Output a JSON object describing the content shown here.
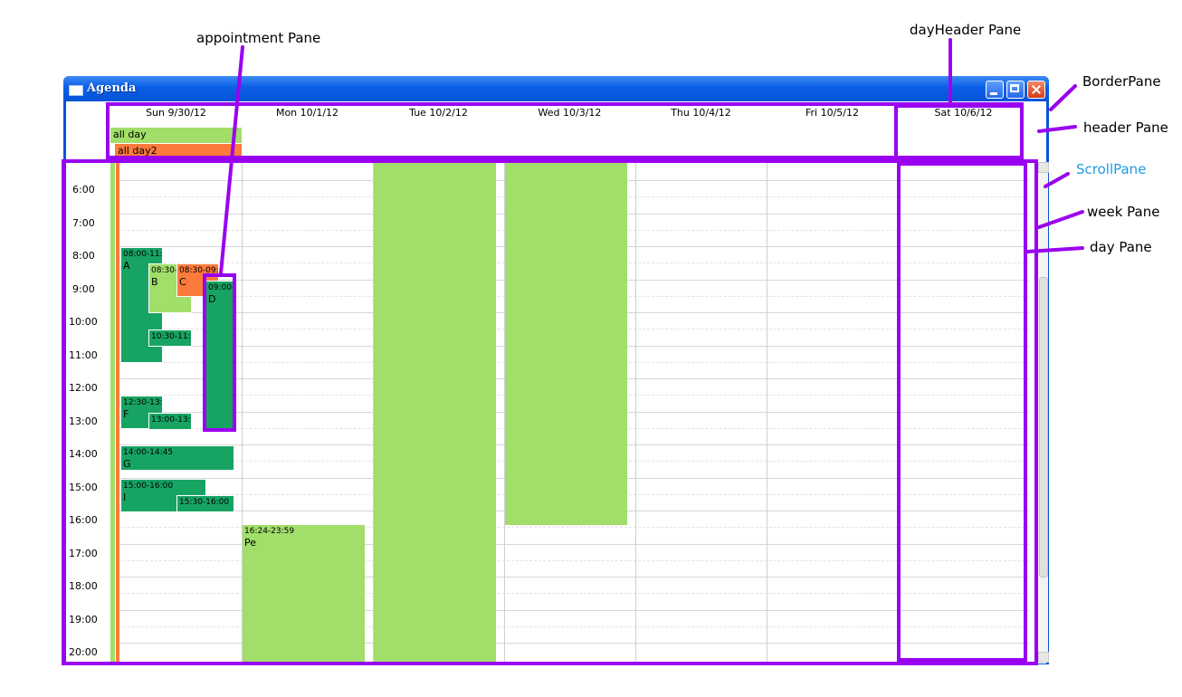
{
  "window": {
    "title": "Agenda"
  },
  "day_headers": [
    "Sun 9/30/12",
    "Mon 10/1/12",
    "Tue 10/2/12",
    "Wed 10/3/12",
    "Thu 10/4/12",
    "Fri 10/5/12",
    "Sat 10/6/12"
  ],
  "all_day": [
    {
      "label": "all day"
    },
    {
      "label": "all day2"
    }
  ],
  "hours": [
    "6:00",
    "7:00",
    "8:00",
    "9:00",
    "10:00",
    "11:00",
    "12:00",
    "13:00",
    "14:00",
    "15:00",
    "16:00",
    "17:00",
    "18:00",
    "19:00",
    "20:00"
  ],
  "appointments": [
    {
      "time": "08:00-11:3",
      "label": "A"
    },
    {
      "time": "08:30-1",
      "label": "B"
    },
    {
      "time": "08:30-09:3",
      "label": "C"
    },
    {
      "time": "09:00-",
      "label": "D"
    },
    {
      "time": "10:30-11:0",
      "label": ""
    },
    {
      "time": "12:30-13:3",
      "label": "F"
    },
    {
      "time": "13:00-13:3",
      "label": ""
    },
    {
      "time": "14:00-14:45",
      "label": "G"
    },
    {
      "time": "15:00-16:00",
      "label": "I"
    },
    {
      "time": "15:30-16:00",
      "label": ""
    },
    {
      "time": "16:24-23:59",
      "label": "Pe"
    }
  ],
  "annotations": {
    "appointment_pane": "appointment Pane",
    "day_header_pane": "dayHeader Pane",
    "border_pane": "BorderPane",
    "header_pane": "header Pane",
    "scroll_pane": "ScrollPane",
    "week_pane": "week Pane",
    "day_pane": "day Pane"
  },
  "colors": {
    "dark_green": "#17a463",
    "light_green": "#a1de6a",
    "orange": "#fb7a3c",
    "annotation_purple": "#9a00f0",
    "scrollpane_label_blue": "#1d9be0"
  }
}
